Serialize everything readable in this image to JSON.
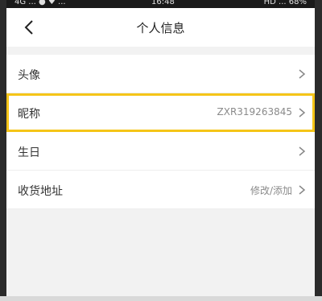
{
  "statusbar": {
    "left": "4G ... ● ♥ ...",
    "time": "16:48",
    "right": "HD ... 68%"
  },
  "navbar": {
    "title": "个人信息"
  },
  "rows": [
    {
      "label": "头像",
      "value": ""
    },
    {
      "label": "昵称",
      "value": "ZXR319263845"
    },
    {
      "label": "生日",
      "value": ""
    },
    {
      "label": "收货地址",
      "value": "修改/添加"
    }
  ],
  "colors": {
    "highlight": "#f5c518",
    "background": "#f2f2f2"
  }
}
